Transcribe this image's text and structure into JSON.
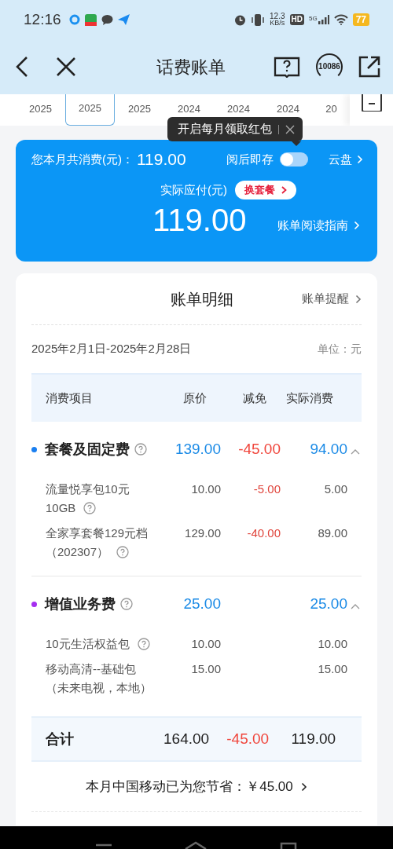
{
  "status_bar": {
    "time": "12:16",
    "speed_value": "12.3",
    "speed_unit": "KB/s",
    "hd": "HD",
    "network": "5G",
    "battery": "77"
  },
  "header": {
    "title": "话费账单",
    "service_number": "10086"
  },
  "months": [
    {
      "year": "2025",
      "selected": false
    },
    {
      "year": "2025",
      "selected": true
    },
    {
      "year": "2025",
      "selected": false
    },
    {
      "year": "2024",
      "selected": false
    },
    {
      "year": "2024",
      "selected": false
    },
    {
      "year": "2024",
      "selected": false
    },
    {
      "year": "20",
      "selected": false
    }
  ],
  "tooltip": {
    "text": "开启每月领取红包"
  },
  "summary": {
    "total_label": "您本月共消费(元)：",
    "total": "119.00",
    "auto_save_label": "阅后即存",
    "auto_save_on": false,
    "cloud_link": "云盘",
    "payable_label": "实际应付(元)",
    "change_plan": "换套餐",
    "payable": "119.00",
    "guide_link": "账单阅读指南"
  },
  "detail": {
    "title": "账单明细",
    "reminder_link": "账单提醒",
    "period": "2025年2月1日-2025年2月28日",
    "unit": "单位：元",
    "columns": [
      "消费项目",
      "原价",
      "减免",
      "实际消费"
    ],
    "groups": [
      {
        "name": "套餐及固定费",
        "color": "#1a7ff0",
        "original": "139.00",
        "discount": "-45.00",
        "actual": "94.00",
        "expanded": true,
        "items": [
          {
            "name_lines": [
              "流量悦享包10元",
              "10GB"
            ],
            "original": "10.00",
            "discount": "-5.00",
            "actual": "5.00",
            "help": true
          },
          {
            "name_lines": [
              "全家享套餐129元档",
              "（202307）"
            ],
            "original": "129.00",
            "discount": "-40.00",
            "actual": "89.00",
            "help": true
          }
        ]
      },
      {
        "name": "增值业务费",
        "color": "#a52ef0",
        "original": "25.00",
        "actual": "25.00",
        "expanded": true,
        "items": [
          {
            "name_lines": [
              "10元生活权益包"
            ],
            "original": "10.00",
            "actual": "10.00",
            "help": true
          },
          {
            "name_lines": [
              "移动高清--基础包",
              "（未来电视，本地）"
            ],
            "original": "15.00",
            "actual": "15.00",
            "help": false
          }
        ]
      }
    ],
    "total": {
      "label": "合计",
      "original": "164.00",
      "discount": "-45.00",
      "actual": "119.00"
    },
    "savings": "本月中国移动已为您节省：￥45.00"
  }
}
